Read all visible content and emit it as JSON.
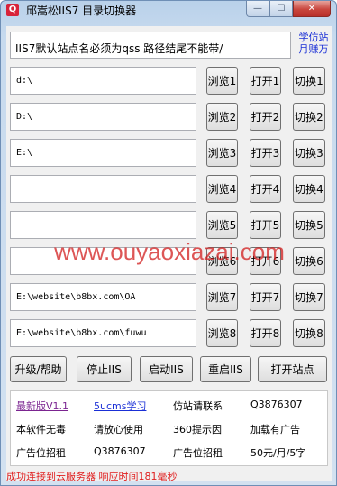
{
  "window": {
    "title": "邱嵩松IIS7 目录切换器",
    "icon_letter": "Q",
    "min_glyph": "—",
    "max_glyph": "☐",
    "close_glyph": "✕"
  },
  "notice": "IIS7默认站点名必须为qss 路径结尾不能带/",
  "learn_link": "学仿站月赚万",
  "rows": [
    {
      "path": "d:\\",
      "browse": "浏览1",
      "open": "打开1",
      "switch": "切换1"
    },
    {
      "path": "D:\\",
      "browse": "浏览2",
      "open": "打开2",
      "switch": "切换2"
    },
    {
      "path": "E:\\",
      "browse": "浏览3",
      "open": "打开3",
      "switch": "切换3"
    },
    {
      "path": "",
      "browse": "浏览4",
      "open": "打开4",
      "switch": "切换4"
    },
    {
      "path": "",
      "browse": "浏览5",
      "open": "打开5",
      "switch": "切换5"
    },
    {
      "path": "",
      "browse": "浏览6",
      "open": "打开6",
      "switch": "切换6"
    },
    {
      "path": "E:\\website\\b8bx.com\\OA",
      "browse": "浏览7",
      "open": "打开7",
      "switch": "切换7"
    },
    {
      "path": "E:\\website\\b8bx.com\\fuwu",
      "browse": "浏览8",
      "open": "打开8",
      "switch": "切换8"
    }
  ],
  "bottom_buttons": {
    "upgrade": "升级/帮助",
    "stop": "停止IIS",
    "start": "启动IIS",
    "restart": "重启IIS",
    "open_site": "打开站点"
  },
  "info": {
    "r1c1": "最新版V1.1",
    "r1c2": "5ucms学习",
    "r1c3": "仿站请联系",
    "r1c4": "Q3876307",
    "r2c1": "本软件无毒",
    "r2c2": "请放心使用",
    "r2c3": "360提示因",
    "r2c4": "加载有广告",
    "r3c1": "广告位招租",
    "r3c2": "Q3876307",
    "r3c3": "广告位招租",
    "r3c4": "50元/月/5字"
  },
  "status": "成功连接到云服务器 响应时间181毫秒",
  "watermark": "www.ouyaoxiazai.com",
  "colors": {
    "status": "#e02020",
    "link_blue": "#1a2fd6",
    "link_purple": "#7b2490",
    "watermark": "#d21e1e"
  }
}
